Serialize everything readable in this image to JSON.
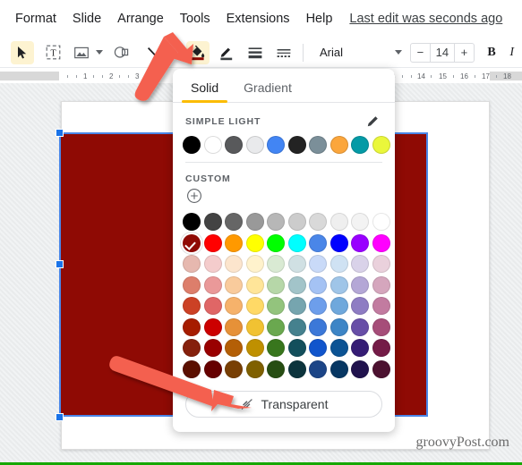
{
  "menubar": {
    "items": [
      {
        "label": "Format"
      },
      {
        "label": "Slide"
      },
      {
        "label": "Arrange"
      },
      {
        "label": "Tools"
      },
      {
        "label": "Extensions"
      },
      {
        "label": "Help"
      }
    ],
    "last_edit": "Last edit was seconds ago"
  },
  "toolbar": {
    "select_tool": "select-arrow",
    "textbox_tool": "text-box",
    "image_tool": "insert-image",
    "shape_tool": "shape",
    "line_tool": "line",
    "fill_tool": "fill-color",
    "border_color_tool": "border-color",
    "border_weight_tool": "border-weight",
    "border_dash_tool": "border-dash",
    "font_name": "Arial",
    "font_size": "14",
    "font_size_decrease": "−",
    "font_size_increase": "+",
    "bold_label": "B",
    "italic_label": "I",
    "fill_indicator_color": "#8f0a04"
  },
  "ruler": {
    "left_ticks": [
      "1",
      "2",
      "3"
    ],
    "right_ticks": [
      "3",
      "14",
      "15",
      "16",
      "17",
      "18"
    ]
  },
  "picker": {
    "tabs": [
      {
        "label": "Solid",
        "active": true
      },
      {
        "label": "Gradient",
        "active": false
      }
    ],
    "simple_light_label": "SIMPLE LIGHT",
    "edit_icon": "pencil-icon",
    "simple_light_colors": [
      "#000000",
      "#ffffff",
      "#58595b",
      "#e9eaec",
      "#4285f4",
      "#232323",
      "#7b8f99",
      "#fba63c",
      "#049aa6",
      "#eaf73b"
    ],
    "custom_label": "CUSTOM",
    "custom_add_icon": "plus-circle-icon",
    "grid_colors": [
      [
        "#000000",
        "#434343",
        "#666666",
        "#999999",
        "#b7b7b7",
        "#cccccc",
        "#d9d9d9",
        "#efefef",
        "#f3f3f3",
        "#ffffff"
      ],
      [
        "#8f0a04",
        "#ff0000",
        "#ff9900",
        "#ffff00",
        "#00ff00",
        "#00ffff",
        "#4a86e8",
        "#0000ff",
        "#9900ff",
        "#ff00ff"
      ],
      [
        "#e6b8af",
        "#f4cccc",
        "#fce5cd",
        "#fff2cc",
        "#d9ead3",
        "#d0e0e3",
        "#c9daf8",
        "#cfe2f3",
        "#d9d2e9",
        "#ead1dc"
      ],
      [
        "#dd7e6b",
        "#ea9999",
        "#f9cb9c",
        "#ffe599",
        "#b6d7a8",
        "#a2c4c9",
        "#a4c2f4",
        "#9fc5e8",
        "#b4a7d6",
        "#d5a6bd"
      ],
      [
        "#cc4125",
        "#e06666",
        "#f6b26b",
        "#ffd966",
        "#93c47d",
        "#76a5af",
        "#6d9eeb",
        "#6fa8dc",
        "#8e7cc3",
        "#c27ba0"
      ],
      [
        "#a61c00",
        "#cc0000",
        "#e69138",
        "#f1c232",
        "#6aa84f",
        "#45818e",
        "#3c78d8",
        "#3d85c6",
        "#674ea7",
        "#a64d79"
      ],
      [
        "#85200c",
        "#990000",
        "#b45f06",
        "#bf9000",
        "#38761d",
        "#134f5c",
        "#1155cc",
        "#0b5394",
        "#351c75",
        "#741b47"
      ],
      [
        "#5b0f00",
        "#660000",
        "#783f04",
        "#7f6000",
        "#274e13",
        "#0c343d",
        "#1c4587",
        "#073763",
        "#20124d",
        "#4c1130"
      ]
    ],
    "selected_grid_row": 1,
    "selected_grid_col": 0,
    "transparent_label": "Transparent",
    "transparent_icon": "fill-slash-icon"
  },
  "canvas": {
    "shape_name": "selected-rectangle",
    "shape_fill": "#8f0a04",
    "selection_border_color": "#4a86e8"
  },
  "annotations": {
    "arrow_color": "#f4614f",
    "arrow_fill_tool": "arrow-pointing-to-fill-tool",
    "arrow_transparent": "arrow-pointing-to-transparent-button"
  },
  "watermark": {
    "text": "groovyPost.com"
  }
}
